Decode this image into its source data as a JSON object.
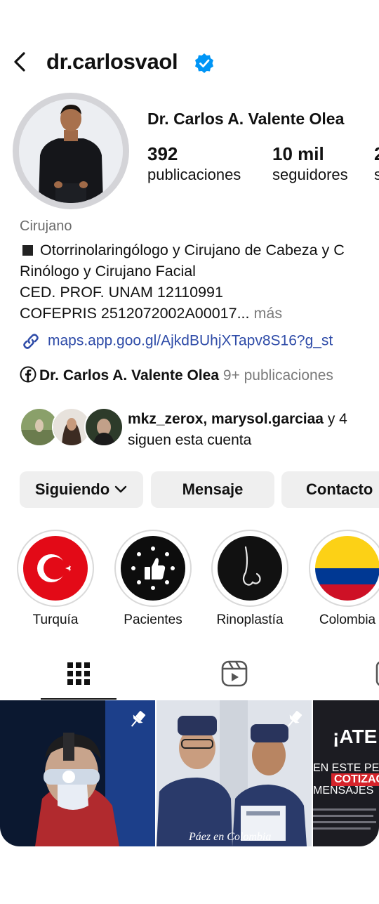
{
  "header": {
    "username": "dr.carlosvaol",
    "verified": true
  },
  "profile": {
    "full_name": "Dr. Carlos A. Valente Olea",
    "stats": [
      {
        "value": "392",
        "label": "publicaciones"
      },
      {
        "value": "10 mil",
        "label": "seguidores"
      },
      {
        "value": "2",
        "label": "s"
      }
    ],
    "category": "Cirujano",
    "bio_lines": [
      "Otorrinolaringólogo y Cirujano de Cabeza y C",
      "Rinólogo y Cirujano Facial",
      "CED. PROF. UNAM 12110991",
      "COFEPRIS 2512072002A00017..."
    ],
    "more_label": "más",
    "link": "maps.app.goo.gl/AjkdBUhjXTapv8S16?g_st",
    "facebook": {
      "name": "Dr. Carlos A. Valente Olea",
      "count": "9+ publicaciones"
    },
    "followed_by": {
      "names": "mkz_zerox, marysol.garciaa",
      "rest": " y 4",
      "line2": "siguen esta cuenta"
    }
  },
  "buttons": {
    "following": "Siguiendo",
    "message": "Mensaje",
    "contact": "Contacto"
  },
  "highlights": [
    {
      "label": "Turquía"
    },
    {
      "label": "Pacientes"
    },
    {
      "label": "Rinoplastía"
    },
    {
      "label": "Colombia"
    }
  ],
  "tabs": [
    {
      "icon": "grid-icon",
      "active": true
    },
    {
      "icon": "reels-icon",
      "active": false
    },
    {
      "icon": "tagged-icon",
      "active": false
    }
  ],
  "posts": [
    {
      "pinned": true
    },
    {
      "pinned": true,
      "overlay_text": "Páez en Colombia"
    },
    {
      "pinned": false,
      "lines": [
        "¡ATE",
        "EN ESTE PE",
        "COTIZAC",
        "MENSAJES"
      ]
    }
  ],
  "colors": {
    "accent": "#0095f6",
    "link": "#2f4ca8",
    "button_bg": "#efefef"
  }
}
